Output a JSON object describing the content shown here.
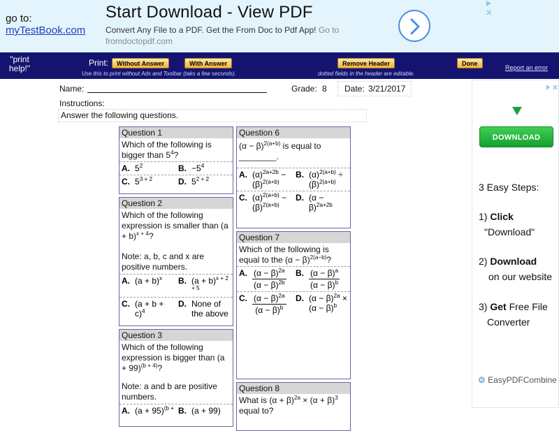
{
  "ad": {
    "goto_label": "go to:",
    "goto_link": "myTestBook.com",
    "title": "Start Download - View PDF",
    "desc_main": "Convert Any File to a PDF. Get the From Doc to Pdf App!",
    "desc_go": "Go to",
    "desc_url": "fromdoctopdf.com",
    "arrow_icon": "chevron-right-icon",
    "accent": "#4a90e2"
  },
  "toolbar": {
    "print_help": "\"print help!\"",
    "print_label": "Print:",
    "without_answer": "Without Answer",
    "with_answer": "With Answer",
    "remove_header": "Remove Header",
    "done": "Done",
    "report": "Report an error",
    "note_print": "Use this to print without Ads and Toolbar (taks a few seconds).",
    "note_dotted": "dotted fields in the header are editable.",
    "bg": "#141470"
  },
  "side_ad": {
    "download": "DOWNLOAD",
    "steps": "3 Easy Steps:",
    "s1_num": "1)",
    "s1_bold": "Click",
    "s1_rest": "\"Download\"",
    "s2_num": "2)",
    "s2_bold": "Download",
    "s2_rest": "on our website",
    "s3_num": "3)",
    "s3_bold": "Get",
    "s3_rest1": "Free File",
    "s3_rest2": "Converter",
    "logo": "EasyPDFCombine"
  },
  "sheet": {
    "name_label": "Name:",
    "grade_label": "Grade:",
    "grade": "8",
    "date_label": "Date:",
    "date": "3/21/2017",
    "instructions_label": "Instructions:",
    "instructions": "Answer the following questions."
  },
  "questions": {
    "q1": {
      "title": "Question 1",
      "text": "Which of the following is bigger than 5",
      "text_sup": "4",
      "text_end": "?",
      "a_let": "A.",
      "b_let": "B.",
      "c_let": "C.",
      "d_let": "D."
    },
    "q2": {
      "title": "Question 2",
      "text": "Which of the following expression is smaller than (a + b)",
      "text_sup": "x + 4",
      "text_end": "?",
      "note": "Note: a, b, c and x are positive numbers.",
      "a_let": "A.",
      "b_let": "B.",
      "c_let": "C.",
      "d_let": "D.",
      "d_val": "None of the above"
    },
    "q3": {
      "title": "Question 3",
      "text": "Which of the following expression is bigger than (a + 99)",
      "text_sup": "(b + 4)",
      "text_end": "?",
      "note": "Note: a and b are positive numbers.",
      "a_let": "A.",
      "b_let": "B."
    },
    "q6": {
      "title": "Question 6",
      "text_blank": "is equal to ________.",
      "a_let": "A.",
      "b_let": "B.",
      "c_let": "C.",
      "d_let": "D."
    },
    "q7": {
      "title": "Question 7",
      "text": "Which of the following is equal to the (α − β)",
      "text_sup": "2(a−b)",
      "text_end": "?",
      "a_let": "A.",
      "b_let": "B.",
      "c_let": "C.",
      "d_let": "D."
    },
    "q8": {
      "title": "Question 8",
      "text": "What is (α + β)",
      "text_end": "equal to?"
    }
  }
}
